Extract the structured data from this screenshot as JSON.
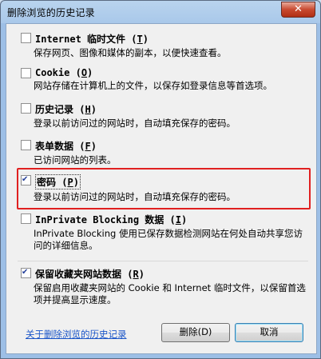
{
  "window": {
    "title": "删除浏览的历史记录",
    "close_label": "✕"
  },
  "options": [
    {
      "label": "Internet 临时文件",
      "key": "T",
      "checked": false,
      "desc": "保存网页、图像和媒体的副本，以便快速查看。"
    },
    {
      "label": "Cookie",
      "key": "O",
      "checked": false,
      "desc": "网站存储在计算机上的文件，以保存如登录信息等首选项。"
    },
    {
      "label": "历史记录",
      "key": "H",
      "checked": false,
      "desc": "登录以前访问过的网站时，自动填充保存的密码。"
    },
    {
      "label": "表单数据",
      "key": "F",
      "checked": false,
      "desc": "已访问网站的列表。"
    },
    {
      "label": "密码",
      "key": "P",
      "checked": true,
      "desc": "登录以前访问过的网站时，自动填充保存的密码。"
    },
    {
      "label": "InPrivate Blocking 数据",
      "key": "I",
      "checked": false,
      "desc": "InPrivate Blocking 使用已保存数据检测网站在何处自动共享您访问的详细信息。"
    },
    {
      "label": "保留收藏夹网站数据",
      "key": "R",
      "checked": true,
      "desc": "保留启用收藏夹网站的 Cookie 和 Internet 临时文件，以保留首选项并提高显示速度。"
    }
  ],
  "footer": {
    "link": "关于删除浏览的历史记录",
    "delete_label": "删除(D)",
    "cancel_label": "取消"
  },
  "watermark": "牛牛牛"
}
